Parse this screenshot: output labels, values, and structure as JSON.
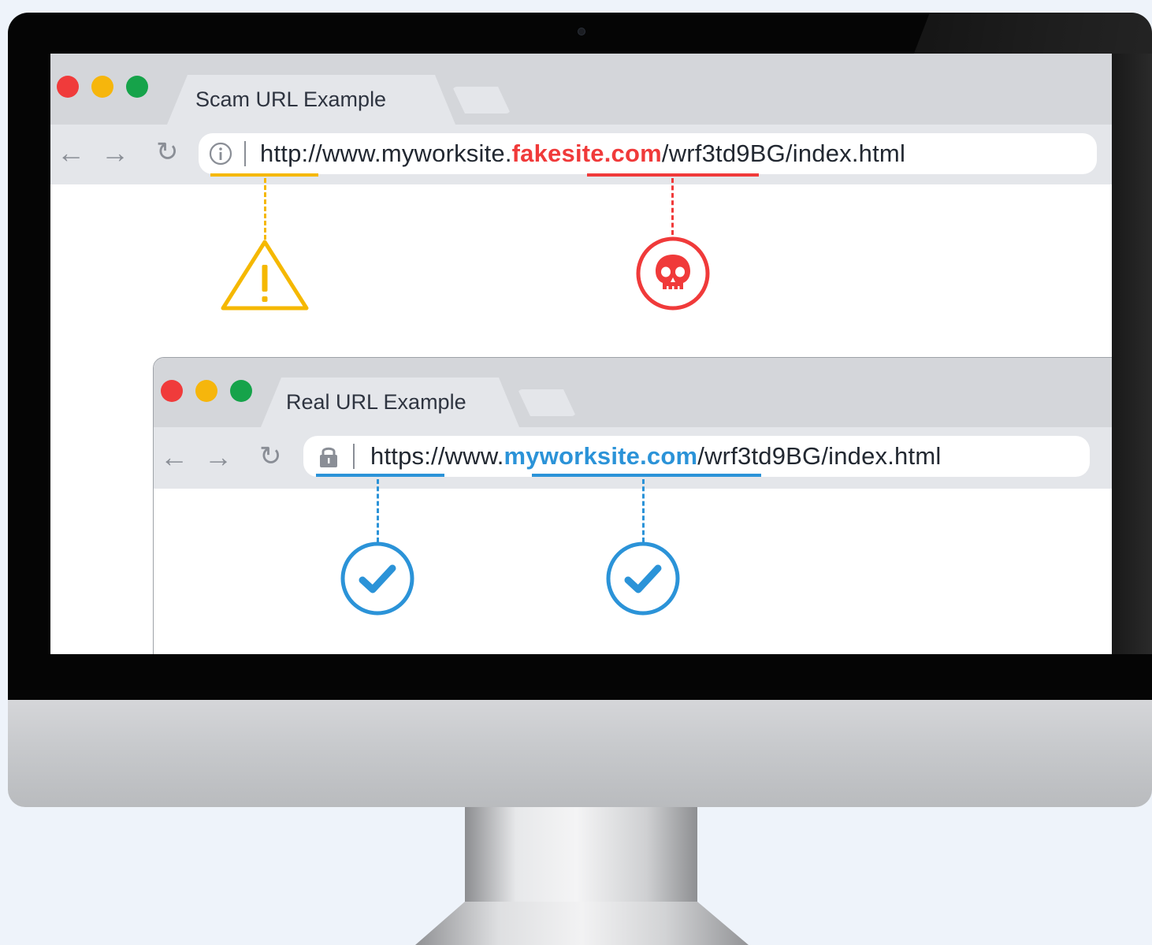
{
  "scam_browser": {
    "tab_title": "Scam URL Example",
    "url": {
      "scheme": "http",
      "prefix": "://www.myworksite.",
      "domain": "fakesite.com",
      "path": "/wrf3td9BG/index.html"
    },
    "security_icon": "info-icon",
    "markers": [
      "warning-icon",
      "skull-icon"
    ]
  },
  "real_browser": {
    "tab_title": "Real URL Example",
    "url": {
      "scheme": "https",
      "prefix": "://www.",
      "domain": "myworksite.com",
      "path": "/wrf3td9BG/index.html"
    },
    "security_icon": "lock-icon",
    "markers": [
      "check-icon",
      "check-icon"
    ]
  },
  "colors": {
    "warning": "#f5b800",
    "danger": "#f03a3a",
    "safe": "#2b93d8",
    "traffic_red": "#f03b3b",
    "traffic_yellow": "#f6b60c",
    "traffic_green": "#16a34a"
  }
}
